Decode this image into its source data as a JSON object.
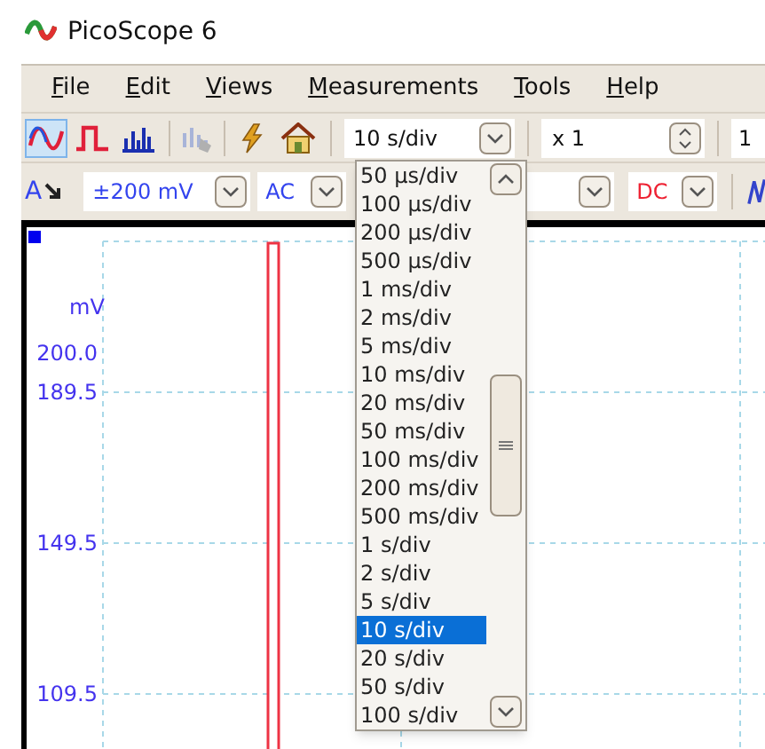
{
  "window": {
    "title": "PicoScope 6"
  },
  "menu": [
    "File",
    "Edit",
    "Views",
    "Measurements",
    "Tools",
    "Help"
  ],
  "modes": [
    {
      "kind": "scope",
      "selected": true
    },
    {
      "kind": "persistence",
      "selected": false
    },
    {
      "kind": "spectrum",
      "selected": false
    }
  ],
  "toolbar": {
    "timebase": "10 s/div",
    "multiplier": "x 1",
    "field_3": "1"
  },
  "channel_bar": {
    "channel": "A",
    "range": "±200 mV",
    "coupling": "AC",
    "coupling_2": "DC"
  },
  "scope": {
    "unit": "mV",
    "axis_labels": [
      "200.0",
      "189.5",
      "149.5",
      "109.5"
    ]
  },
  "timebase_list": [
    {
      "label": "50 µs/div",
      "selected": false
    },
    {
      "label": "100 µs/div",
      "selected": false
    },
    {
      "label": "200 µs/div",
      "selected": false
    },
    {
      "label": "500 µs/div",
      "selected": false
    },
    {
      "label": "1 ms/div",
      "selected": false
    },
    {
      "label": "2 ms/div",
      "selected": false
    },
    {
      "label": "5 ms/div",
      "selected": false
    },
    {
      "label": "10 ms/div",
      "selected": false
    },
    {
      "label": "20 ms/div",
      "selected": false
    },
    {
      "label": "50 ms/div",
      "selected": false
    },
    {
      "label": "100 ms/div",
      "selected": false
    },
    {
      "label": "200 ms/div",
      "selected": false
    },
    {
      "label": "500 ms/div",
      "selected": false
    },
    {
      "label": "1 s/div",
      "selected": false
    },
    {
      "label": "2 s/div",
      "selected": false
    },
    {
      "label": "5 s/div",
      "selected": false
    },
    {
      "label": "10 s/div",
      "selected": true
    },
    {
      "label": "20 s/div",
      "selected": false
    },
    {
      "label": "50 s/div",
      "selected": false
    },
    {
      "label": "100 s/div",
      "selected": false
    }
  ]
}
